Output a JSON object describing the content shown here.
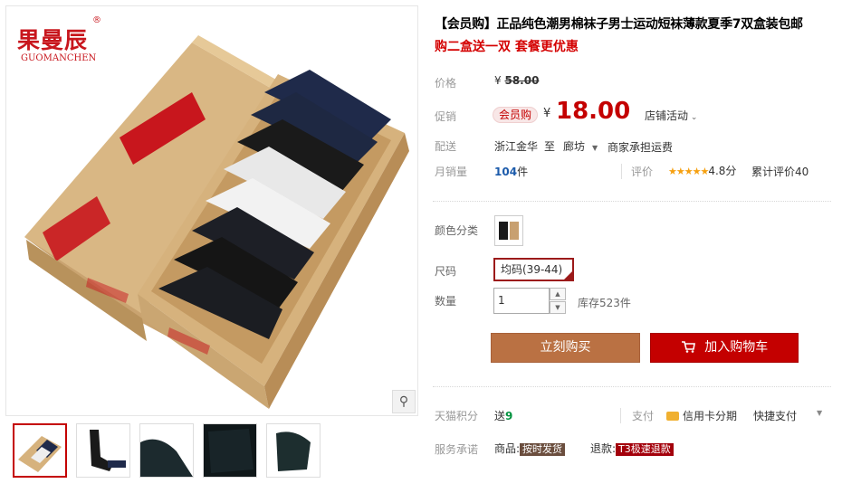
{
  "gallery": {
    "brand_cn": "果曼辰",
    "brand_reg": "®",
    "brand_en": "GUOMANCHEN",
    "zoom_icon": "magnifier-icon"
  },
  "product": {
    "title": "【会员购】正品纯色潮男棉袜子男士运动短袜薄款夏季7双盒装包邮",
    "subtitle": "购二盒送一双 套餐更优惠"
  },
  "price": {
    "label": "价格",
    "currency": "¥",
    "original": "58.00",
    "promo_label": "促销",
    "promo_badge": "会员购",
    "current": "18.00",
    "shop_activity": "店铺活动"
  },
  "shipping": {
    "label": "配送",
    "from": "浙江金华",
    "to_word": "至",
    "to": "廊坊",
    "fee": "商家承担运费"
  },
  "sales": {
    "label": "月销量",
    "count": "104",
    "unit": "件",
    "review_label": "评价",
    "stars": "★★★★★",
    "score": "4.8分",
    "total_reviews": "累计评价40"
  },
  "options": {
    "color_label": "颜色分类",
    "size_label": "尺码",
    "size_value": "均码(39-44)",
    "qty_label": "数量",
    "qty_value": "1",
    "stock": "库存523件",
    "qty_up": "▲",
    "qty_down": "▼"
  },
  "actions": {
    "buy_now": "立刻购买",
    "add_to_cart": "加入购物车",
    "cart_icon": "cart-icon"
  },
  "footer": {
    "points_label": "天猫积分",
    "points_prefix": "送",
    "points_value": "9",
    "pay_label": "支付",
    "pay_credit": "信用卡分期",
    "pay_fast": "快捷支付",
    "promise_label": "服务承诺",
    "goods_prefix": "商品:",
    "goods_badge": "按时发货",
    "refund_prefix": "退款:",
    "refund_badge": "T3极速退款"
  },
  "colors": {
    "accent_red": "#c40000",
    "buy_brown": "#ba7143",
    "box_kraft": "#d9b784"
  }
}
